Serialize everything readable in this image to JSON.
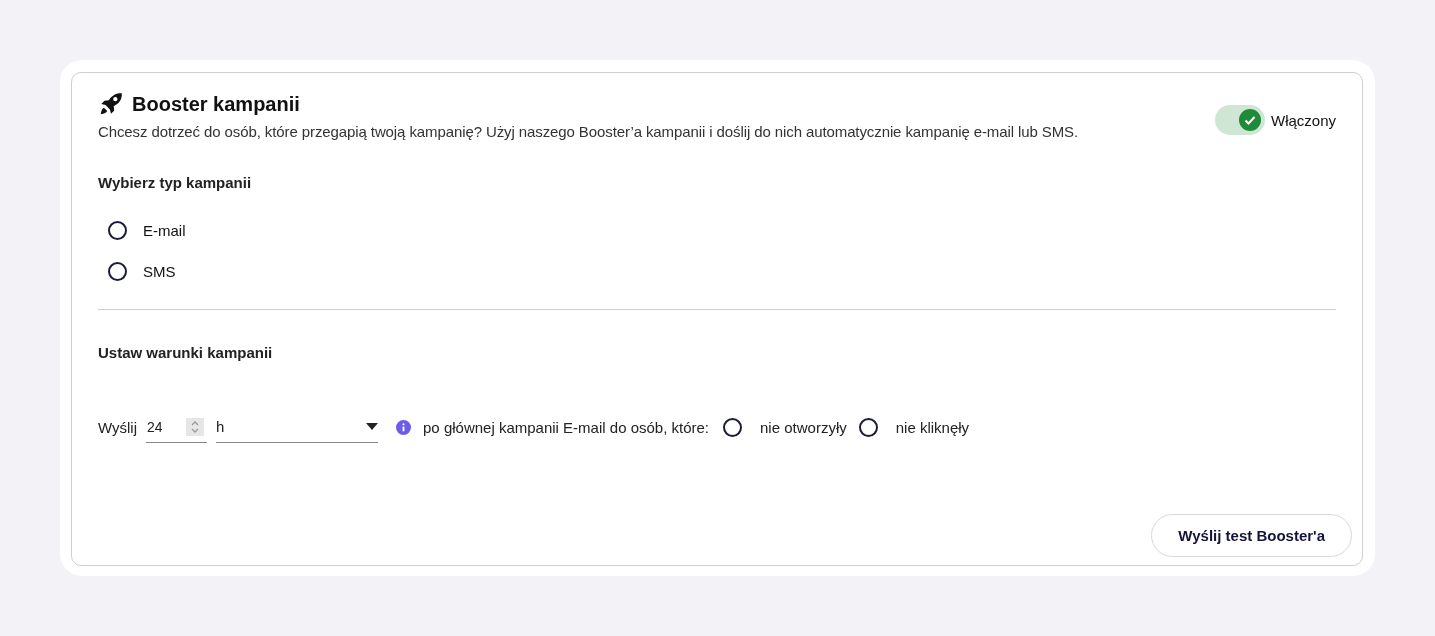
{
  "header": {
    "title": "Booster kampanii",
    "description": "Chcesz dotrzeć do osób, które przegapią twoją kampanię? Użyj naszego Booster’a kampanii i doślij do nich automatycznie kampanię e-mail lub SMS."
  },
  "toggle": {
    "label": "Włączony",
    "on": true
  },
  "campaign_type": {
    "heading": "Wybierz typ kampanii",
    "options": [
      {
        "label": "E-mail",
        "selected": false
      },
      {
        "label": "SMS",
        "selected": false
      }
    ]
  },
  "conditions": {
    "heading": "Ustaw warunki kampanii",
    "send_label": "Wyślij",
    "hours_value": "24",
    "unit_value": "h",
    "text": "po głównej kampanii E-mail do osób, które:",
    "options": [
      {
        "label": "nie otworzyły",
        "selected": false
      },
      {
        "label": "nie kliknęły",
        "selected": false
      }
    ]
  },
  "buttons": [
    "Wyślij test Booster'a"
  ]
}
